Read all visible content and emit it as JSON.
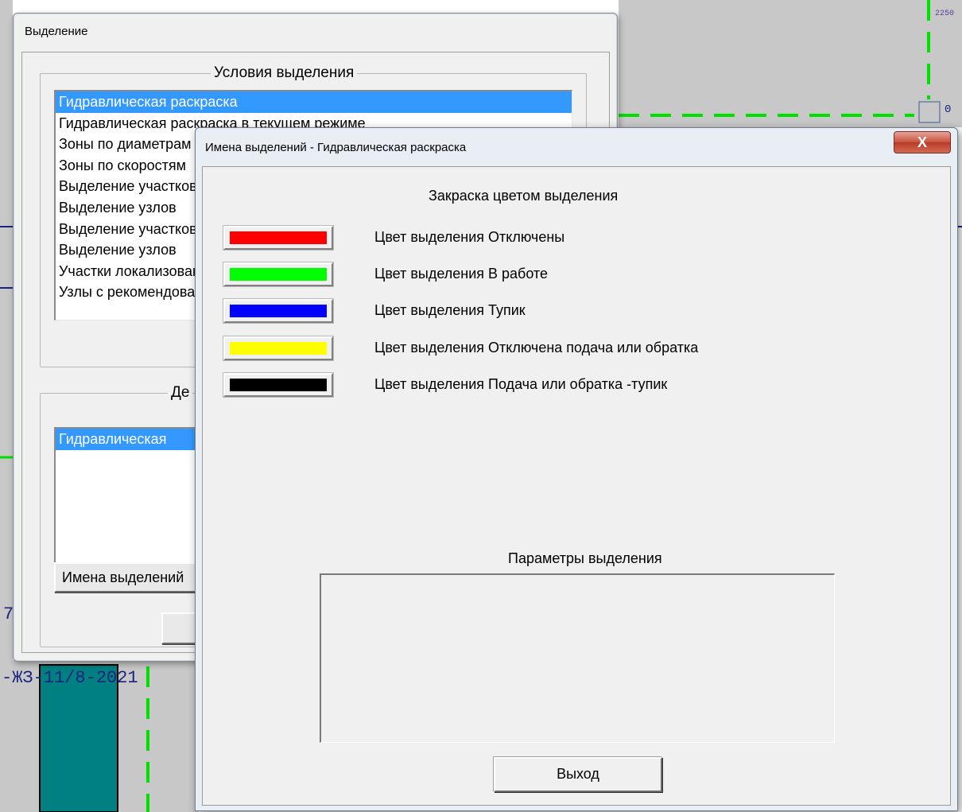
{
  "background": {
    "drawing_label": "-ЖЗ-11/8-2021",
    "left_mark": "7",
    "top_right_mark": "2250",
    "edge_mark": "0"
  },
  "window_selection": {
    "title": "Выделение",
    "conditions_group_title": "Условия  выделения",
    "conditions": [
      "Гидравлическая раскраска",
      "Гидравлическая раскраска в текущем режиме",
      "Зоны по диаметрам",
      "Зоны по скоростям",
      "Выделение участков",
      "Выделение узлов",
      "Выделение участков",
      "Выделение узлов",
      "Участки локализованные",
      "Узлы с рекомендованные"
    ],
    "selected_condition_index": 0,
    "actions_group_title": "Де",
    "actions_list": [
      "Гидравлическая"
    ],
    "names_button_label": "Имена выделений"
  },
  "window_names": {
    "title": "Имена выделений - Гидравлическая раскраска",
    "close_label": "X",
    "fill_heading": "Закраска цветом выделения",
    "color_rows": [
      {
        "label": "Цвет выделения  Отключены",
        "color": "#ff0000"
      },
      {
        "label": "Цвет выделения  В работе",
        "color": "#00ff00"
      },
      {
        "label": "Цвет выделения  Тупик",
        "color": "#0000ff"
      },
      {
        "label": "Цвет выделения  Отключена подача или обратка",
        "color": "#ffff00"
      },
      {
        "label": "Цвет выделения  Подача или обратка -тупик",
        "color": "#000000"
      }
    ],
    "params_heading": "Параметры выделения",
    "params_text": "",
    "exit_label": "Выход"
  }
}
